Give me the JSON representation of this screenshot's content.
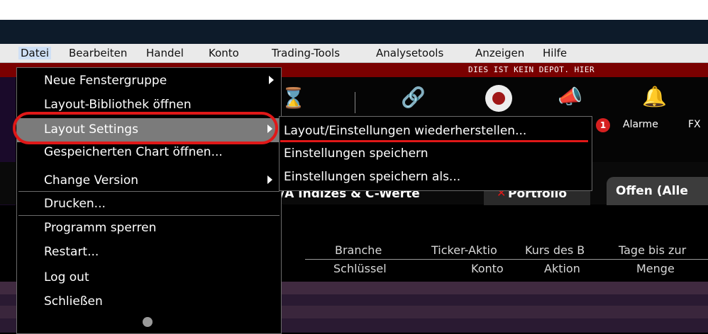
{
  "menubar": [
    "Datei",
    "Bearbeiten",
    "Handel",
    "Konto",
    "Trading-Tools",
    "Analysetools",
    "Anzeigen",
    "Hilfe"
  ],
  "notice": "DIES IST KEIN DEPOT. HIER",
  "toolbar": {
    "alarme": "Alarme",
    "fx": "FX",
    "badge_count": "1"
  },
  "tabs": {
    "indizes": "/A Indizes & C-Werte",
    "portfolio": "Portfolio",
    "offen": "Offen (Alle"
  },
  "columns_top": [
    "Branche",
    "Ticker-Aktio",
    "Kurs des B",
    "Tage bis zur"
  ],
  "columns_bottom": [
    "Schlüssel",
    "Konto",
    "Aktion",
    "Menge"
  ],
  "menu": {
    "neue_fenstergruppe": "Neue Fenstergruppe",
    "layout_bibliothek": "Layout-Bibliothek öffnen",
    "layout_settings": "Layout Settings",
    "gespeicherten_chart": "Gespeicherten Chart öffnen...",
    "change_version": "Change Version",
    "drucken": "Drucken...",
    "programm_sperren": "Programm sperren",
    "restart": "Restart...",
    "log_out": "Log out",
    "schliessen": "Schließen"
  },
  "submenu": {
    "wiederherstellen": "Layout/Einstellungen wiederherstellen...",
    "speichern": "Einstellungen speichern",
    "speichern_als": "Einstellungen speichern als..."
  },
  "colors": {
    "accent_red": "#e01818",
    "menu_bg": "#000000",
    "selected_bg": "#7b7b7b",
    "notice_bg": "#7a0000"
  }
}
